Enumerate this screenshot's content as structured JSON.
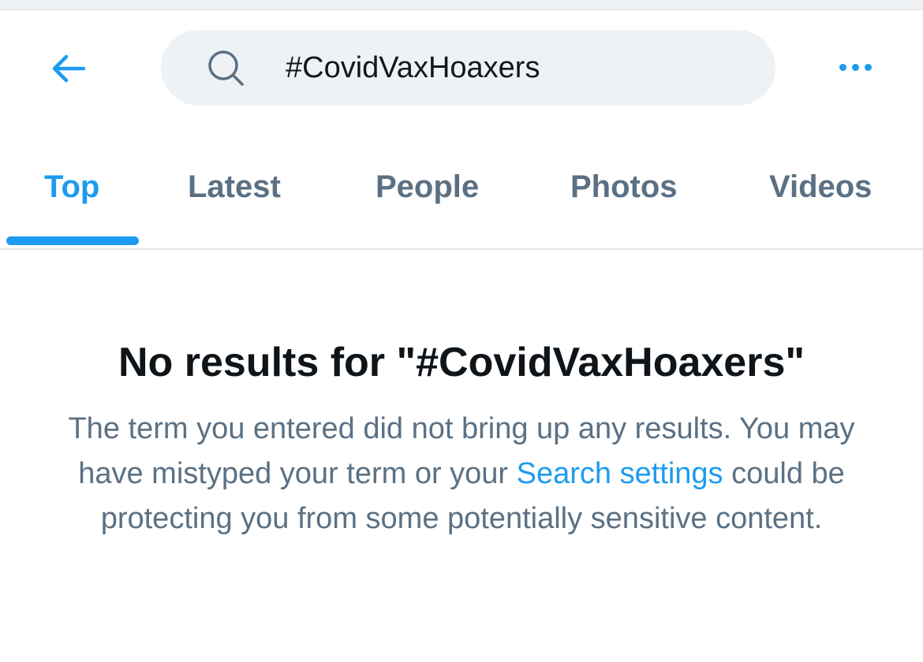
{
  "header": {
    "search_query": "#CovidVaxHoaxers"
  },
  "tabs": [
    {
      "label": "Top",
      "active": true
    },
    {
      "label": "Latest",
      "active": false
    },
    {
      "label": "People",
      "active": false
    },
    {
      "label": "Photos",
      "active": false
    },
    {
      "label": "Videos",
      "active": false
    }
  ],
  "empty_state": {
    "title": "No results for \"#CovidVaxHoaxers\"",
    "body_line1": "The term you entered did not bring up any results.",
    "body_part2": "You may have mistyped your term or your ",
    "link_text": "Search settings",
    "body_part3": " could be protecting you from some potentially sensitive content."
  },
  "colors": {
    "accent": "#1d9bf0",
    "muted_text": "#5b7083",
    "primary_text": "#0f1419",
    "search_bg": "#eef2f4"
  },
  "icons": {
    "back": "arrow-left-icon",
    "search": "search-icon",
    "more": "more-horizontal-icon"
  }
}
